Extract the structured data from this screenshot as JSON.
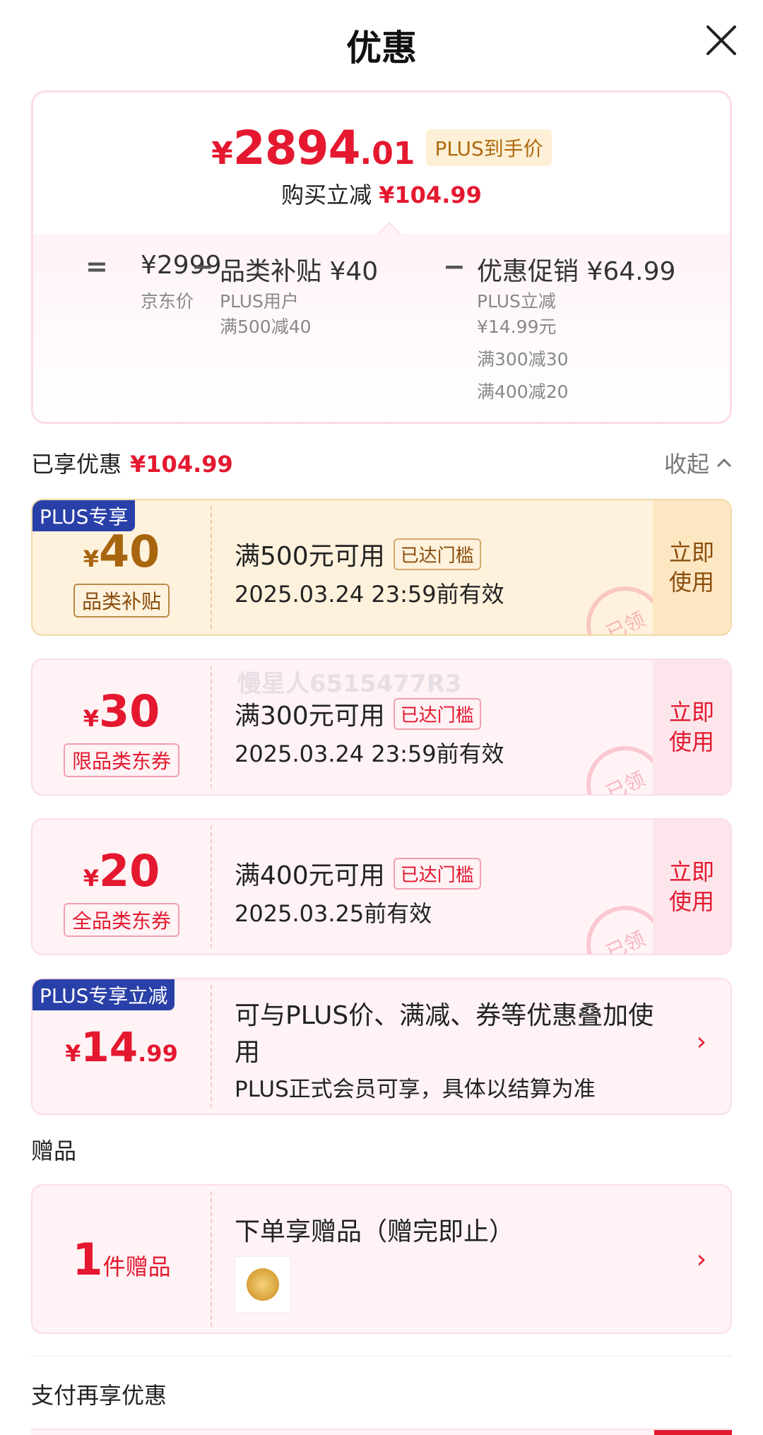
{
  "header": {
    "title": "优惠"
  },
  "summary": {
    "currency": "¥",
    "price_int": "2894",
    "price_dec": ".01",
    "plus_tag": "PLUS到手价",
    "save_label": "购买立减",
    "save_value": "¥104.99",
    "eq": "=",
    "minus": "−",
    "jd_price": "¥2999",
    "jd_label": "京东价",
    "subsidy_title": "品类补贴",
    "subsidy_value": "¥40",
    "subsidy_line1": "PLUS用户",
    "subsidy_line2": "满500减40",
    "promo_title": "优惠促销",
    "promo_value": "¥64.99",
    "promo_line1": "PLUS立减",
    "promo_line2": "¥14.99元",
    "promo_line3": "满300减30",
    "promo_line4": "满400减20"
  },
  "enjoyed": {
    "label": "已享优惠",
    "value": "¥104.99",
    "collapse": "收起"
  },
  "coupons": [
    {
      "corner": "PLUS专享",
      "currency": "¥",
      "amount": "40",
      "category": "品类补贴",
      "condition": "满500元可用",
      "badge": "已达门槛",
      "validity": "2025.03.24 23:59前有效",
      "action": "立即\n使用",
      "stamp": "已领"
    },
    {
      "currency": "¥",
      "amount": "30",
      "category": "限品类东券",
      "condition": "满300元可用",
      "badge": "已达门槛",
      "validity": "2025.03.24 23:59前有效",
      "action": "立即\n使用",
      "stamp": "已领"
    },
    {
      "currency": "¥",
      "amount": "20",
      "category": "全品类东券",
      "condition": "满400元可用",
      "badge": "已达门槛",
      "validity": "2025.03.25前有效",
      "action": "立即\n使用",
      "stamp": "已领"
    }
  ],
  "watermark": "慢星人6515477R3",
  "plus_card": {
    "corner": "PLUS专享立减",
    "currency": "¥",
    "amount_int": "14",
    "amount_dec": ".99",
    "desc": "可与PLUS价、满减、券等优惠叠加使用",
    "note": "PLUS正式会员可享，具体以结算为准",
    "chevron": "›"
  },
  "gift": {
    "section": "赠品",
    "count": "1",
    "count_label": "件赠品",
    "title": "下单享赠品（赠完即止）",
    "chevron": "›"
  },
  "pay": {
    "section": "支付再享优惠"
  }
}
